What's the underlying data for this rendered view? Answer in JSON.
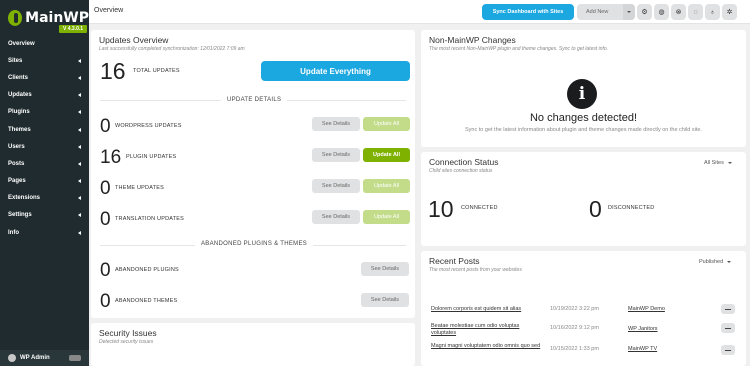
{
  "app": {
    "logo_text": "MainWP",
    "version": "V 4.3.0.1"
  },
  "sidebar": {
    "items": [
      {
        "label": "Overview",
        "has_caret": false
      },
      {
        "label": "Sites",
        "has_caret": true
      },
      {
        "label": "Clients",
        "has_caret": true
      },
      {
        "label": "Updates",
        "has_caret": true
      },
      {
        "label": "Plugins",
        "has_caret": true
      },
      {
        "label": "Themes",
        "has_caret": true
      },
      {
        "label": "Users",
        "has_caret": true
      },
      {
        "label": "Posts",
        "has_caret": true
      },
      {
        "label": "Pages",
        "has_caret": true
      },
      {
        "label": "Extensions",
        "has_caret": true
      },
      {
        "label": "Settings",
        "has_caret": true
      },
      {
        "label": "Info",
        "has_caret": true
      }
    ],
    "footer_label": "WP Admin"
  },
  "header": {
    "title": "Overview",
    "sync_label": "Sync Dashboard with Sites",
    "add_new_label": "Add New",
    "icons": [
      "gear-icon",
      "globe-icon",
      "help-icon",
      "chat-icon",
      "lightbulb-icon",
      "settings-icon"
    ]
  },
  "updates_overview": {
    "title": "Updates Overview",
    "subtitle": "Last successfully completed synchronization: 12/01/2022 7:09 am",
    "total": "16",
    "total_label": "TOTAL UPDATES",
    "update_everything_label": "Update Everything",
    "details_heading": "UPDATE DETAILS",
    "rows": [
      {
        "count": "0",
        "label": "WORDPRESS UPDATES",
        "see": "See Details",
        "update": "Update All",
        "active": false
      },
      {
        "count": "16",
        "label": "PLUGIN UPDATES",
        "see": "See Details",
        "update": "Update All",
        "active": true
      },
      {
        "count": "0",
        "label": "THEME UPDATES",
        "see": "See Details",
        "update": "Update All",
        "active": false
      },
      {
        "count": "0",
        "label": "TRANSLATION UPDATES",
        "see": "See Details",
        "update": "Update All",
        "active": false
      }
    ],
    "abandoned_heading": "ABANDONED PLUGINS & THEMES",
    "abandoned": [
      {
        "count": "0",
        "label": "ABANDONED PLUGINS",
        "see": "See Details"
      },
      {
        "count": "0",
        "label": "ABANDONED THEMES",
        "see": "See Details"
      }
    ]
  },
  "security": {
    "title": "Security Issues",
    "subtitle": "Detected security issues"
  },
  "non_mainwp": {
    "title": "Non-MainWP Changes",
    "subtitle": "The most recent Non-MainWP plugin and theme changes. Sync to get latest info.",
    "empty_title": "No changes detected!",
    "empty_sub": "Sync to get the latest information about plugin and theme changes made directly on the child site."
  },
  "connection": {
    "title": "Connection Status",
    "subtitle": "Child sites connection status",
    "filter": "All Sites",
    "connected": "10",
    "connected_label": "CONNECTED",
    "disconnected": "0",
    "disconnected_label": "DISCONNECTED"
  },
  "recent_posts": {
    "title": "Recent Posts",
    "subtitle": "The most recent posts from your websites",
    "filter": "Published",
    "posts": [
      {
        "title": "Dolorem corporis est quidem sit alias",
        "date": "10/19/2022 3:22 pm",
        "site": "MainWP Demo"
      },
      {
        "title": "Beatae molestiae cum odio voluptas voluptates",
        "date": "10/16/2022 9:12 pm",
        "site": "WP Janitors"
      },
      {
        "title": "Magni magni voluptatem odio omnis quo sed",
        "date": "10/15/2022 1:33 pm",
        "site": "MainWP TV"
      }
    ]
  }
}
